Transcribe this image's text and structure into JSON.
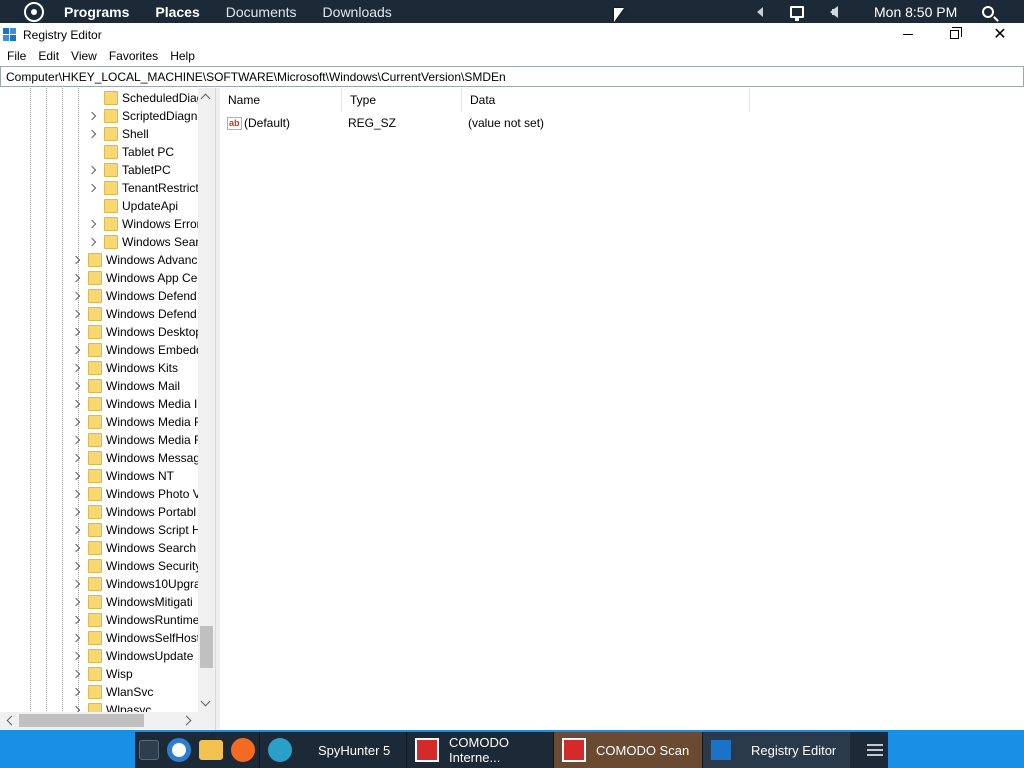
{
  "top_panel": {
    "menus": [
      "Programs",
      "Places",
      "Documents",
      "Downloads"
    ],
    "clock": "Mon 8:50 PM"
  },
  "window": {
    "title": "Registry Editor",
    "close_glyph": "✕"
  },
  "menubar": [
    "File",
    "Edit",
    "View",
    "Favorites",
    "Help"
  ],
  "address": "Computer\\HKEY_LOCAL_MACHINE\\SOFTWARE\\Microsoft\\Windows\\CurrentVersion\\SMDEn",
  "tree": {
    "children": [
      {
        "label": "ScheduledDiag",
        "expandable": false
      },
      {
        "label": "ScriptedDiagn",
        "expandable": true
      },
      {
        "label": "Shell",
        "expandable": true
      },
      {
        "label": "Tablet PC",
        "expandable": false
      },
      {
        "label": "TabletPC",
        "expandable": true
      },
      {
        "label": "TenantRestrict",
        "expandable": true
      },
      {
        "label": "UpdateApi",
        "expandable": false
      },
      {
        "label": "Windows Error",
        "expandable": true
      },
      {
        "label": "Windows Sear",
        "expandable": true
      }
    ],
    "siblings": [
      {
        "label": "Windows Advanc",
        "expandable": true
      },
      {
        "label": "Windows App Ce",
        "expandable": true
      },
      {
        "label": "Windows Defend",
        "expandable": true
      },
      {
        "label": "Windows Defend",
        "expandable": true
      },
      {
        "label": "Windows Desktop",
        "expandable": true
      },
      {
        "label": "Windows Embedd",
        "expandable": true
      },
      {
        "label": "Windows Kits",
        "expandable": true
      },
      {
        "label": "Windows Mail",
        "expandable": true
      },
      {
        "label": "Windows Media I",
        "expandable": true
      },
      {
        "label": "Windows Media F",
        "expandable": true
      },
      {
        "label": "Windows Media F",
        "expandable": true
      },
      {
        "label": "Windows Messag",
        "expandable": true
      },
      {
        "label": "Windows NT",
        "expandable": true
      },
      {
        "label": "Windows Photo V",
        "expandable": true
      },
      {
        "label": "Windows Portabl",
        "expandable": true
      },
      {
        "label": "Windows Script H",
        "expandable": true
      },
      {
        "label": "Windows Search",
        "expandable": true
      },
      {
        "label": "Windows Security",
        "expandable": true
      },
      {
        "label": "Windows10Upgra",
        "expandable": true
      },
      {
        "label": "WindowsMitigati",
        "expandable": true
      },
      {
        "label": "WindowsRuntime",
        "expandable": true
      },
      {
        "label": "WindowsSelfHost",
        "expandable": true
      },
      {
        "label": "WindowsUpdate",
        "expandable": true
      },
      {
        "label": "Wisp",
        "expandable": true
      },
      {
        "label": "WlanSvc",
        "expandable": true
      },
      {
        "label": "Wlpasvc",
        "expandable": true
      }
    ]
  },
  "list": {
    "columns": [
      "Name",
      "Type",
      "Data"
    ],
    "rows": [
      {
        "name": "(Default)",
        "type": "REG_SZ",
        "data": "(value not set)",
        "icon_text": "ab"
      }
    ]
  },
  "taskbar": {
    "tasks": [
      {
        "label": "SpyHunter 5",
        "icon": "spyhunter-icon"
      },
      {
        "label": "COMODO Interne...",
        "icon": "comodo-icon"
      },
      {
        "label": "COMODO Scan",
        "icon": "comodo-icon"
      },
      {
        "label": "Registry Editor",
        "icon": "registry-icon"
      }
    ],
    "launchers": [
      "show-desktop-icon",
      "chromium-icon",
      "files-icon",
      "firefox-icon"
    ]
  },
  "colors": {
    "panel": "#1c2a38",
    "taskbar_accent": "#1a8fe6",
    "folder": "#f8d775"
  }
}
